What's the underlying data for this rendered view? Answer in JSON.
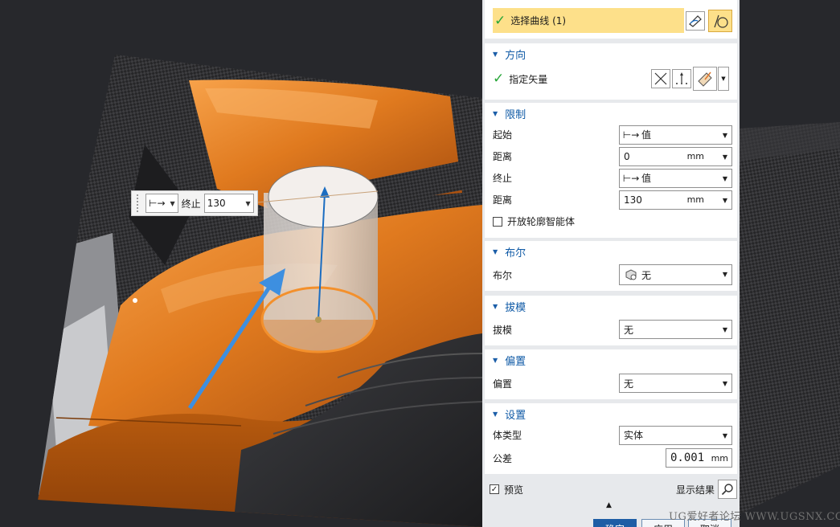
{
  "viewport": {
    "mini_toolbar": {
      "limit_icon": "⊢→",
      "end_label": "终止",
      "end_value": "130"
    }
  },
  "dialog": {
    "section_curve": {
      "select_label": "选择曲线 (1)"
    },
    "section_direction": {
      "title": "方向",
      "vector_label": "指定矢量"
    },
    "section_limits": {
      "title": "限制",
      "start_label": "起始",
      "start_value": "值",
      "start_distance_label": "距离",
      "start_distance_value": "0",
      "end_label": "终止",
      "end_value": "值",
      "end_distance_label": "距离",
      "end_distance_value": "130",
      "unit": "mm",
      "open_profile_label": "开放轮廓智能体"
    },
    "section_boolean": {
      "title": "布尔",
      "boolean_label": "布尔",
      "boolean_value": "无"
    },
    "section_draft": {
      "title": "拔模",
      "draft_label": "拔模",
      "draft_value": "无"
    },
    "section_offset": {
      "title": "偏置",
      "offset_label": "偏置",
      "offset_value": "无"
    },
    "section_settings": {
      "title": "设置",
      "body_type_label": "体类型",
      "body_type_value": "实体",
      "tolerance_label": "公差",
      "tolerance_value": "0.001",
      "tolerance_unit": "mm"
    },
    "preview_label": "预览",
    "show_result_label": "显示结果",
    "footer": {
      "ok": "确定",
      "apply": "应用",
      "cancel": "取消"
    }
  },
  "watermark": "UG爱好者论坛 WWW.UGSNX.COM",
  "colors": {
    "accent_blue": "#0f5aa6",
    "selection_yellow": "#fde08a",
    "check_green": "#27a638",
    "car_orange": "#e07a1f",
    "panel_bg": "#e7e9ec",
    "viewport_bg": "#27282c"
  }
}
